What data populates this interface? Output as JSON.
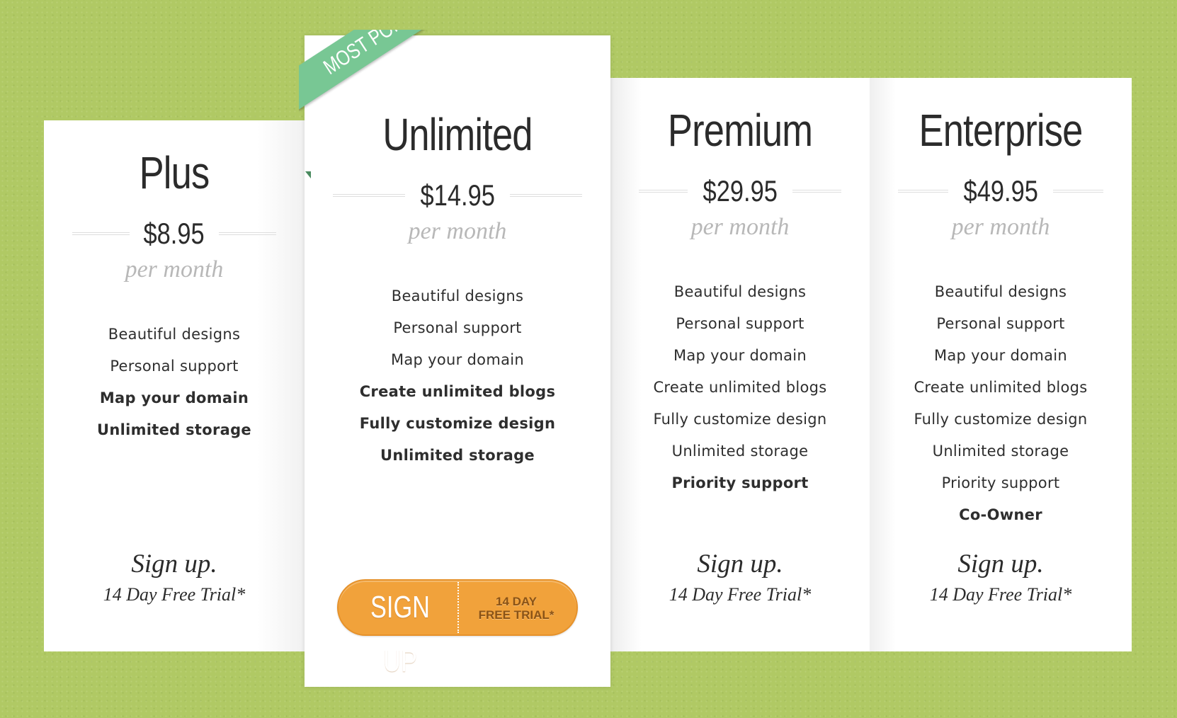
{
  "plans": {
    "plus": {
      "name": "Plus",
      "price": "$8.95",
      "period": "per month",
      "features": [
        {
          "label": "Beautiful designs"
        },
        {
          "label": "Personal support"
        },
        {
          "label": "Map your domain"
        },
        {
          "label": "Unlimited storage"
        }
      ],
      "signup_label": "Sign up.",
      "trial_label": "14 Day Free Trial*"
    },
    "unlimited": {
      "ribbon": "MOST POPULAR",
      "name": "Unlimited",
      "price": "$14.95",
      "period": "per month",
      "features": [
        {
          "label": "Beautiful designs"
        },
        {
          "label": "Personal support"
        },
        {
          "label": "Map your domain"
        },
        {
          "label": "Create unlimited blogs"
        },
        {
          "label": "Fully customize design"
        },
        {
          "label": "Unlimited storage"
        }
      ],
      "button": {
        "main": "SIGN UP",
        "sub_line1": "14 DAY",
        "sub_line2": "FREE TRIAL*"
      }
    },
    "premium": {
      "name": "Premium",
      "price": "$29.95",
      "period": "per month",
      "features": [
        {
          "label": "Beautiful designs"
        },
        {
          "label": "Personal support"
        },
        {
          "label": "Map your domain"
        },
        {
          "label": "Create unlimited blogs"
        },
        {
          "label": "Fully customize design"
        },
        {
          "label": "Unlimited storage"
        },
        {
          "label": "Priority support"
        }
      ],
      "signup_label": "Sign up.",
      "trial_label": "14 Day Free Trial*"
    },
    "enterprise": {
      "name": "Enterprise",
      "price": "$49.95",
      "period": "per month",
      "features": [
        {
          "label": "Beautiful designs"
        },
        {
          "label": "Personal support"
        },
        {
          "label": "Map your domain"
        },
        {
          "label": "Create unlimited blogs"
        },
        {
          "label": "Fully customize design"
        },
        {
          "label": "Unlimited storage"
        },
        {
          "label": "Priority support"
        },
        {
          "label": "Co-Owner"
        }
      ],
      "signup_label": "Sign up.",
      "trial_label": "14 Day Free Trial*"
    }
  },
  "colors": {
    "background": "#b0c964",
    "ribbon": "#78c794",
    "button": "#f1a23b",
    "button_subtext": "#8a5316"
  }
}
